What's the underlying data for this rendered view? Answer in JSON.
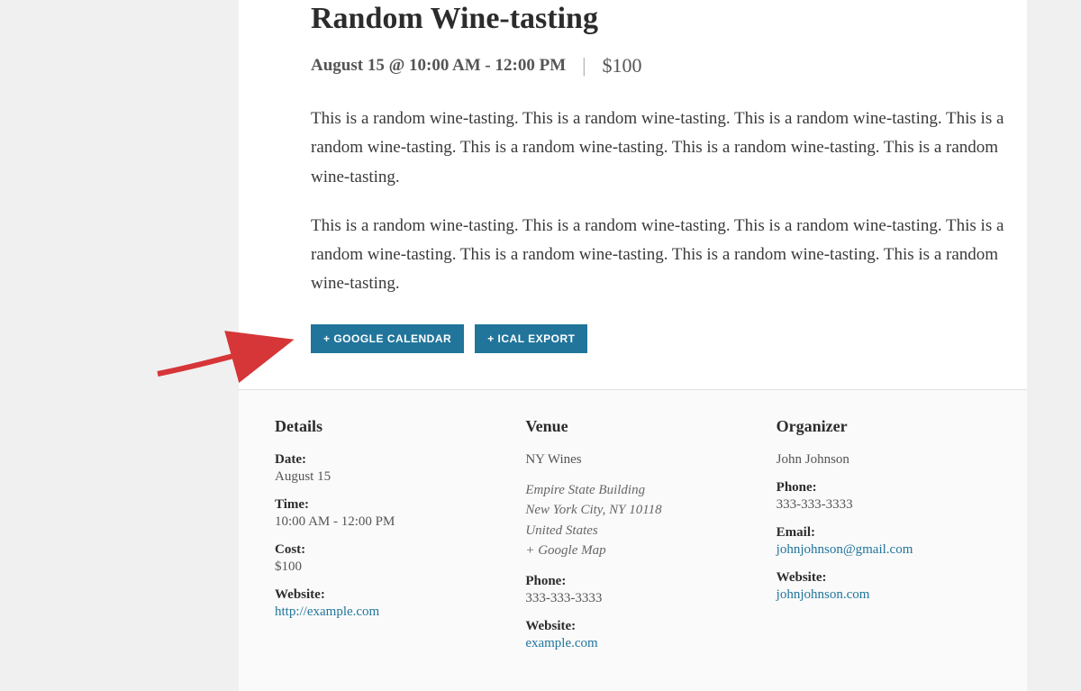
{
  "event": {
    "title": "Random Wine-tasting",
    "datetime": "August 15 @ 10:00 AM - 12:00 PM",
    "price": "$100",
    "description_p1": "This is a random wine-tasting. This is a random wine-tasting. This is a random wine-tasting. This is a random wine-tasting. This is a random wine-tasting. This is a random wine-tasting. This is a random wine-tasting.",
    "description_p2": "This is a random wine-tasting. This is a random wine-tasting. This is a random wine-tasting. This is a random wine-tasting. This is a random wine-tasting. This is a random wine-tasting. This is a random wine-tasting."
  },
  "buttons": {
    "google_calendar": "+ GOOGLE CALENDAR",
    "ical_export": "+ ICAL EXPORT"
  },
  "details": {
    "heading": "Details",
    "date_label": "Date:",
    "date_value": "August 15",
    "time_label": "Time:",
    "time_value": "10:00 AM - 12:00 PM",
    "cost_label": "Cost:",
    "cost_value": "$100",
    "website_label": "Website:",
    "website_value": "http://example.com"
  },
  "venue": {
    "heading": "Venue",
    "name": "NY Wines",
    "address_line1": "Empire State Building",
    "address_line2": "New York City, NY 10118",
    "address_line3": "United States",
    "map_link": "+ Google Map",
    "phone_label": "Phone:",
    "phone_value": "333-333-3333",
    "website_label": "Website:",
    "website_value": "example.com"
  },
  "organizer": {
    "heading": "Organizer",
    "name": "John Johnson",
    "phone_label": "Phone:",
    "phone_value": "333-333-3333",
    "email_label": "Email:",
    "email_value": "johnjohnson@gmail.com",
    "website_label": "Website:",
    "website_value": "johnjohnson.com"
  }
}
